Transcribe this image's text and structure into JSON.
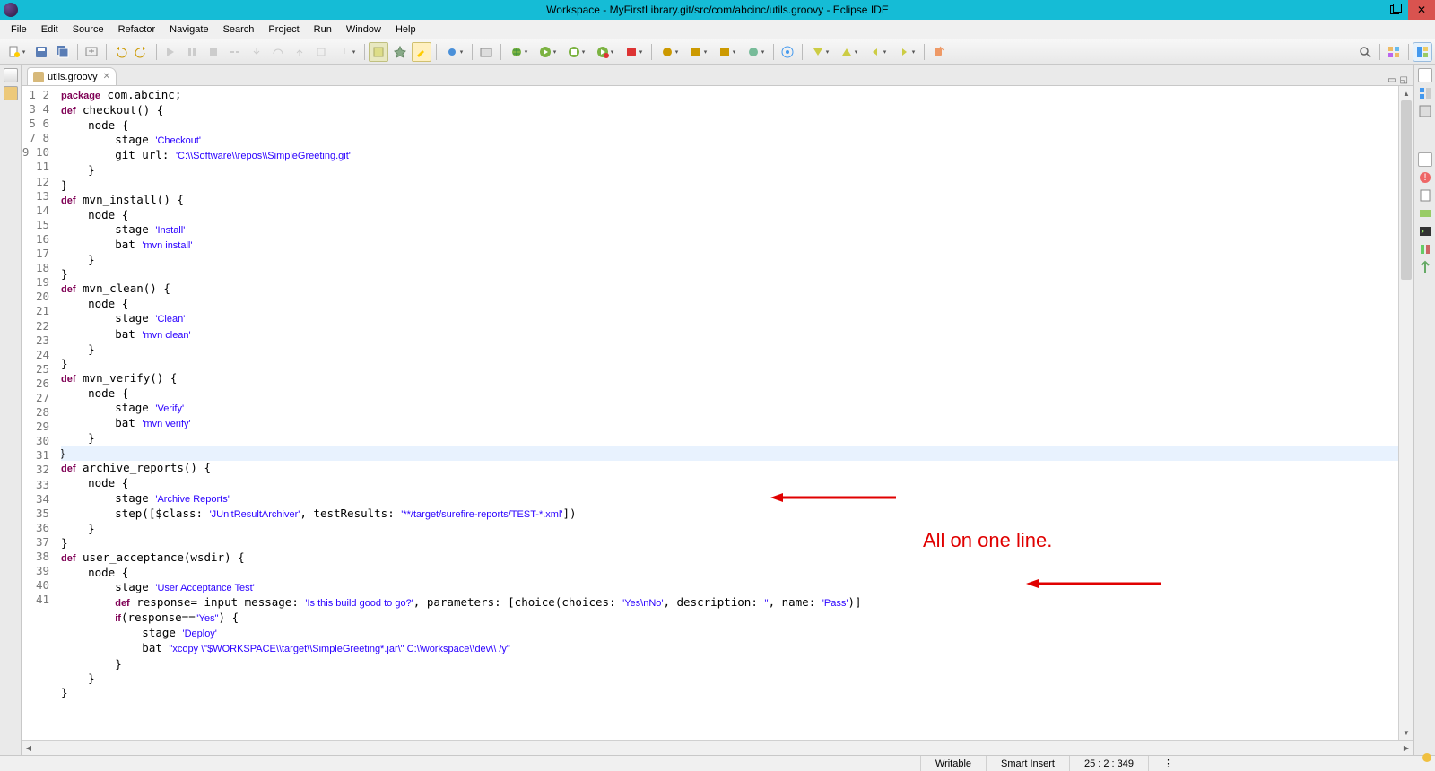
{
  "window": {
    "title": "Workspace - MyFirstLibrary.git/src/com/abcinc/utils.groovy - Eclipse IDE"
  },
  "menu": [
    "File",
    "Edit",
    "Source",
    "Refactor",
    "Navigate",
    "Search",
    "Project",
    "Run",
    "Window",
    "Help"
  ],
  "tab": {
    "label": "utils.groovy"
  },
  "lines": 41,
  "code": {
    "t1a": "package",
    "t1b": " com.abcinc;",
    "t2a": "def",
    "t2b": " checkout() {",
    "t3": "    node {",
    "t4a": "        stage ",
    "t4b": "'Checkout'",
    "t5a": "        git url: ",
    "t5b": "'C:\\\\Software\\\\repos\\\\SimpleGreeting.git'",
    "t6": "    }",
    "t7": "}",
    "t8a": "def",
    "t8b": " mvn_install() {",
    "t9": "    node {",
    "t10a": "        stage ",
    "t10b": "'Install'",
    "t11a": "        bat ",
    "t11b": "'mvn install'",
    "t12": "    }",
    "t13": "}",
    "t14a": "def",
    "t14b": " mvn_clean() {",
    "t15": "    node {",
    "t16a": "        stage ",
    "t16b": "'Clean'",
    "t17a": "        bat ",
    "t17b": "'mvn clean'",
    "t18": "    }",
    "t19": "}",
    "t20a": "def",
    "t20b": " mvn_verify() {",
    "t21": "    node {",
    "t22a": "        stage ",
    "t22b": "'Verify'",
    "t23a": "        bat ",
    "t23b": "'mvn verify'",
    "t24": "    }",
    "t25": "}",
    "t26a": "def",
    "t26b": " archive_reports() {",
    "t27": "    node {",
    "t28a": "        stage ",
    "t28b": "'Archive Reports'",
    "t29a": "        step([$class: ",
    "t29b": "'JUnitResultArchiver'",
    "t29c": ", testResults: ",
    "t29d": "'**/target/surefire-reports/TEST-*.xml'",
    "t29e": "])",
    "t30": "    }",
    "t31": "}",
    "t32a": "def",
    "t32b": " user_acceptance(wsdir) {",
    "t33": "    node {",
    "t34a": "        stage ",
    "t34b": "'User Acceptance Test'",
    "t35a": "        ",
    "t35b": "def",
    "t35c": " response= input message: ",
    "t35d": "'Is this build good to go?'",
    "t35e": ", parameters: [choice(choices: ",
    "t35f": "'Yes\\nNo'",
    "t35g": ", description: ",
    "t35h": "''",
    "t35i": ", name: ",
    "t35j": "'Pass'",
    "t35k": ")]",
    "t36a": "        ",
    "t36b": "if",
    "t36c": "(response==",
    "t36d": "\"Yes\"",
    "t36e": ") {",
    "t37a": "            stage ",
    "t37b": "'Deploy'",
    "t38a": "            bat ",
    "t38b": "\"xcopy \\\"$WORKSPACE\\\\target\\\\SimpleGreeting*.jar\\\" C:\\\\workspace\\\\dev\\\\ /y\"",
    "t39": "        }",
    "t40": "    }",
    "t41": "}"
  },
  "annotation": "All on one line.",
  "status": {
    "writable": "Writable",
    "insert": "Smart Insert",
    "pos": "25 : 2 : 349"
  }
}
